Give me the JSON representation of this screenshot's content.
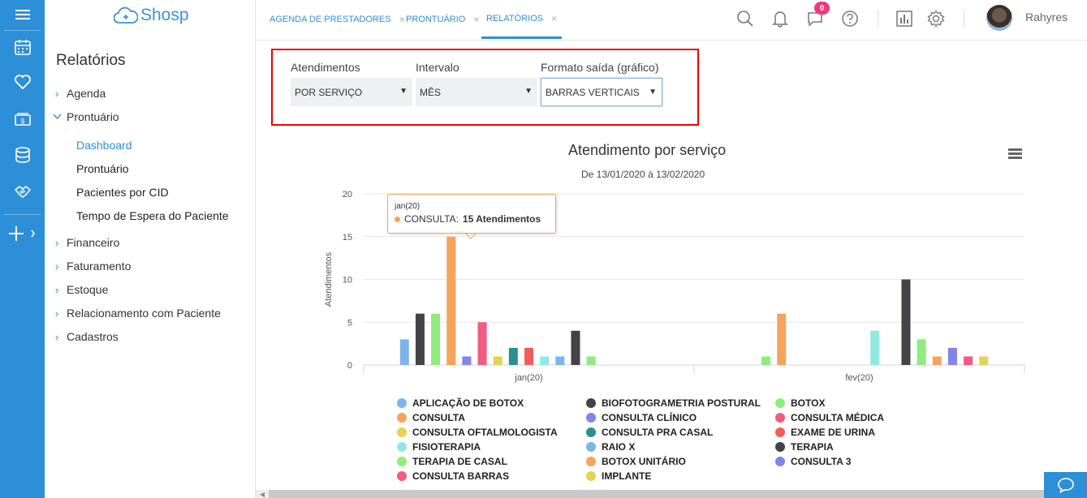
{
  "rail": {
    "icons": [
      "menu-icon",
      "calendar-icon",
      "heart-icon",
      "money-icon",
      "database-icon",
      "handshake-icon",
      "plus-icon"
    ]
  },
  "sidebar": {
    "logo": "Shosp",
    "title": "Relatórios",
    "items": [
      {
        "label": "Agenda",
        "expanded": false
      },
      {
        "label": "Prontuário",
        "expanded": true
      },
      {
        "label": "Financeiro",
        "expanded": false
      },
      {
        "label": "Faturamento",
        "expanded": false
      },
      {
        "label": "Estoque",
        "expanded": false
      },
      {
        "label": "Relacionamento com Paciente",
        "expanded": false
      },
      {
        "label": "Cadastros",
        "expanded": false
      }
    ],
    "subitems": [
      {
        "label": "Dashboard",
        "active": true
      },
      {
        "label": "Prontuário",
        "active": false
      },
      {
        "label": "Pacientes por CID",
        "active": false
      },
      {
        "label": "Tempo de Espera do Paciente",
        "active": false
      }
    ]
  },
  "tabs": [
    {
      "label": "AGENDA DE PRESTADORES",
      "close": "×"
    },
    {
      "label": "PRONTUÁRIO",
      "close": "×"
    },
    {
      "label": "RELATÓRIOS",
      "close": "×"
    }
  ],
  "header": {
    "notification_count": "0",
    "username": "Rahyres"
  },
  "filters": {
    "atendimentos": {
      "label": "Atendimentos",
      "value": "POR SERVIÇO"
    },
    "intervalo": {
      "label": "Intervalo",
      "value": "MÊS"
    },
    "formato": {
      "label": "Formato saída (gráfico)",
      "value": "BARRAS VERTICAIS"
    },
    "arrow": "▼"
  },
  "tooltip": {
    "category": "jan(20)",
    "series": "CONSULTA:",
    "value": "15 Atendimentos"
  },
  "chart_data": {
    "type": "bar",
    "title": "Atendimento por serviço",
    "subtitle": "De 13/01/2020 à 13/02/2020",
    "ylabel": "Atendimentos",
    "xlabel": "",
    "categories": [
      "jan(20)",
      "fev(20)"
    ],
    "ylim": [
      0,
      20
    ],
    "yticks": [
      "0",
      "5",
      "10",
      "15",
      "20"
    ],
    "grid": true,
    "legend_position": "bottom",
    "series": [
      {
        "name": "APLICAÇÃO DE BOTOX",
        "color": "#7cb5ec",
        "values": [
          3,
          0
        ]
      },
      {
        "name": "BIOFOTOGRAMETRIA POSTURAL",
        "color": "#434348",
        "values": [
          6,
          0
        ]
      },
      {
        "name": "BOTOX",
        "color": "#90ed7d",
        "values": [
          6,
          1
        ]
      },
      {
        "name": "CONSULTA",
        "color": "#f7a35c",
        "values": [
          15,
          6
        ]
      },
      {
        "name": "CONSULTA CLÍNICO",
        "color": "#8085e9",
        "values": [
          1,
          0
        ]
      },
      {
        "name": "CONSULTA MÉDICA",
        "color": "#f15c80",
        "values": [
          5,
          0
        ]
      },
      {
        "name": "CONSULTA OFTALMOLOGISTA",
        "color": "#e4d354",
        "values": [
          1,
          0
        ]
      },
      {
        "name": "CONSULTA PRA CASAL",
        "color": "#2b908f",
        "values": [
          2,
          0
        ]
      },
      {
        "name": "EXAME DE URINA",
        "color": "#f45b5b",
        "values": [
          2,
          0
        ]
      },
      {
        "name": "FISIOTERAPIA",
        "color": "#91e8e1",
        "values": [
          1,
          4
        ]
      },
      {
        "name": "RAIO X",
        "color": "#7cb5ec",
        "values": [
          1,
          0
        ]
      },
      {
        "name": "TERAPIA",
        "color": "#434348",
        "values": [
          4,
          10
        ]
      },
      {
        "name": "TERAPIA DE CASAL",
        "color": "#90ed7d",
        "values": [
          1,
          3
        ]
      },
      {
        "name": "BOTOX UNITÁRIO",
        "color": "#f7a35c",
        "values": [
          0,
          1
        ]
      },
      {
        "name": "CONSULTA 3",
        "color": "#8085e9",
        "values": [
          0,
          2
        ]
      },
      {
        "name": "CONSULTA BARRAS",
        "color": "#f15c80",
        "values": [
          0,
          1
        ]
      },
      {
        "name": "IMPLANTE",
        "color": "#e4d354",
        "values": [
          0,
          1
        ]
      }
    ]
  }
}
